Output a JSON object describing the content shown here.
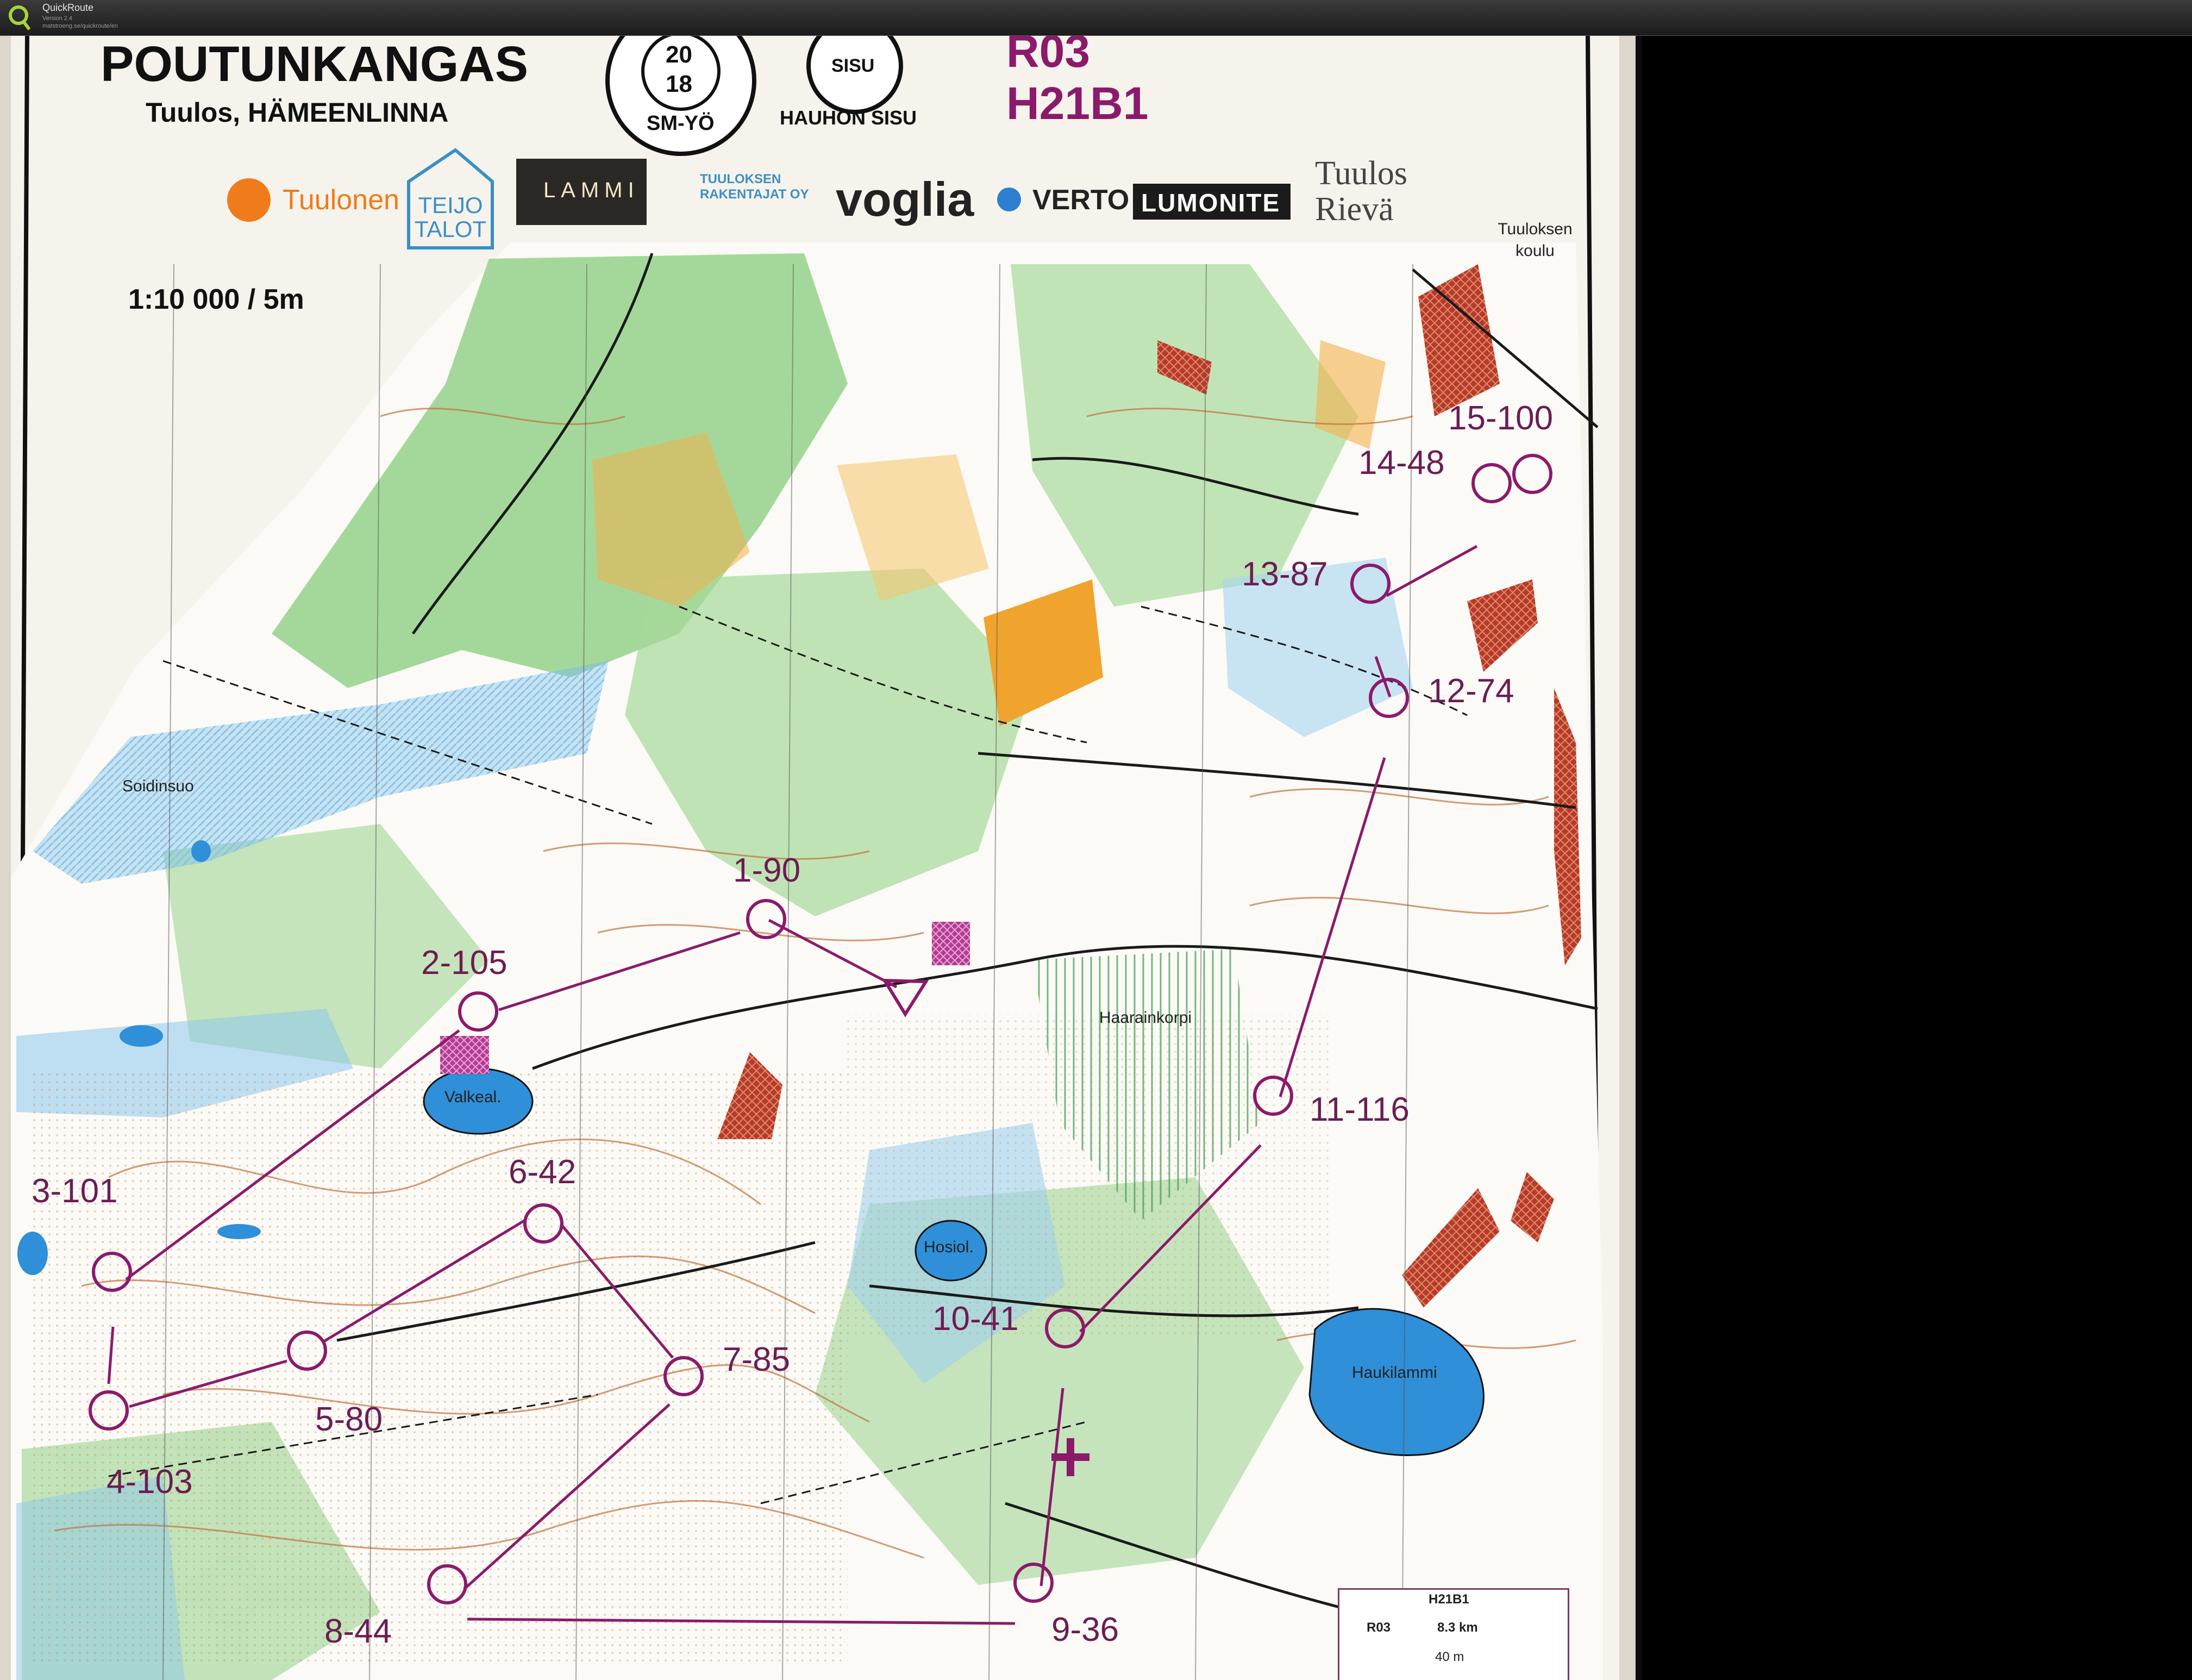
{
  "window": {
    "title": "QuickRoute",
    "subtitle_version": "Version 2.4",
    "subtitle_url": "matstroeng.se/quickroute/en"
  },
  "map": {
    "event_name": "POUTUNKANGAS",
    "location": "Tuulos, HÄMEENLINNA",
    "seal_top": "20",
    "seal_bottom": "18",
    "seal_caption": "SM-YÖ",
    "club_badge": "SISU",
    "club_name": "HAUHON SISU",
    "course_code": "R03",
    "course_class": "H21B1",
    "scale": "1:10 000 / 5m",
    "sponsors": [
      "Tuulonen",
      "TEIJO TALOT",
      "LAMMI",
      "TUULOKSEN RAKENTAJAT OY",
      "voglia",
      "VERTO",
      "LUMONITE",
      "Tuulos Rievä"
    ],
    "place_names": {
      "school": "Tuuloksen koulu",
      "bog": "Soidinsuo",
      "lake1": "Valkeal.",
      "lake2": "Hosiol.",
      "lake3": "Haukilammi",
      "area": "Haarainkorpi"
    },
    "controls": [
      {
        "label": "1-90"
      },
      {
        "label": "2-105"
      },
      {
        "label": "3-101"
      },
      {
        "label": "4-103"
      },
      {
        "label": "5-80"
      },
      {
        "label": "6-42"
      },
      {
        "label": "7-85"
      },
      {
        "label": "8-44"
      },
      {
        "label": "9-36"
      },
      {
        "label": "10-41"
      },
      {
        "label": "11-116"
      },
      {
        "label": "12-74"
      },
      {
        "label": "13-87"
      },
      {
        "label": "14-48"
      },
      {
        "label": "15-100"
      }
    ],
    "legend": {
      "class": "H21B1",
      "course": "R03",
      "length": "8.3 km",
      "climb": "40 m"
    }
  },
  "colors": {
    "course_purple": "#8b1a6b",
    "forest_green": "#7fc57a",
    "open_yellow": "#f2a93b",
    "water_blue": "#2f8fd8",
    "paper": "#f4f1ea"
  }
}
